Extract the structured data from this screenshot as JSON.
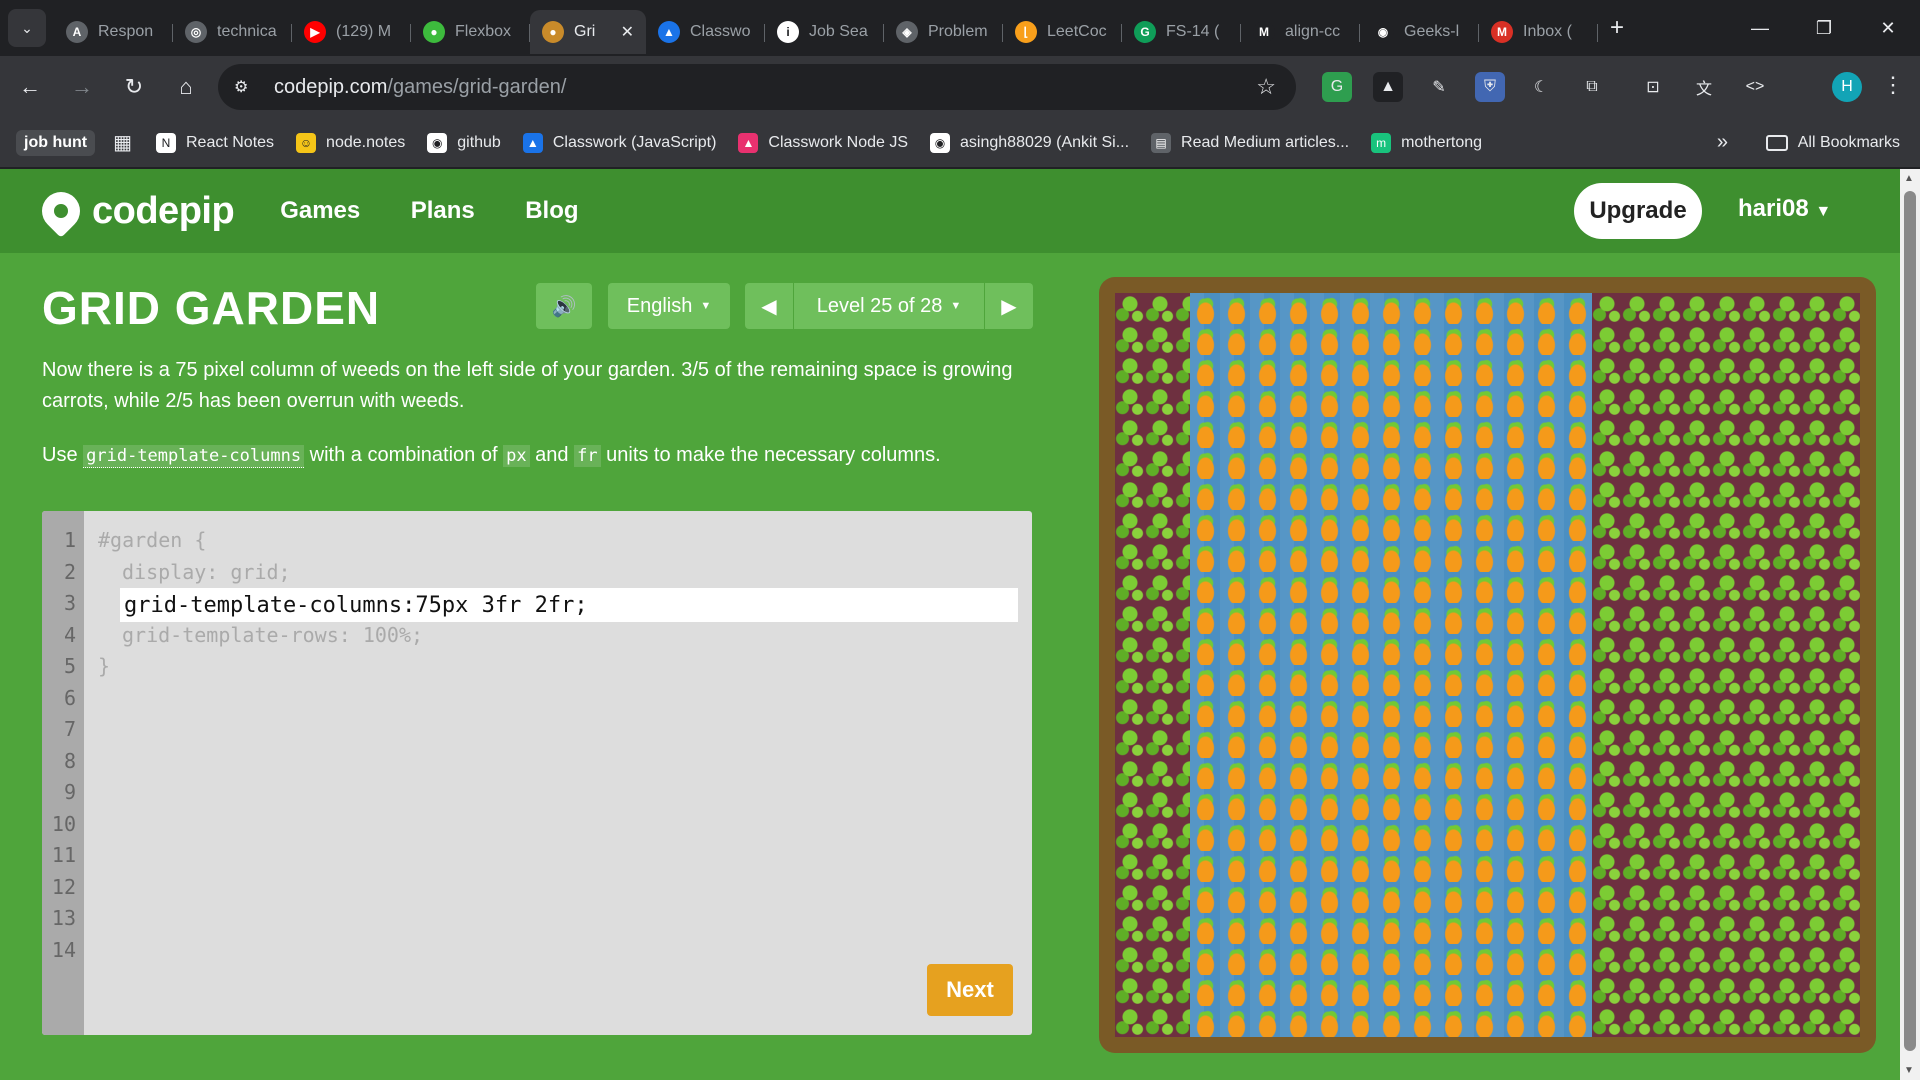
{
  "browser": {
    "tabs": [
      {
        "title": "Respon",
        "fav_color": "#5f6368",
        "fav_glyph": "A",
        "icon": "response-icon"
      },
      {
        "title": "technica",
        "fav_color": "#5f6368",
        "fav_glyph": "◎",
        "icon": "openai-icon"
      },
      {
        "title": "(129) M",
        "fav_color": "#ff0000",
        "fav_glyph": "▶",
        "icon": "youtube-icon"
      },
      {
        "title": "Flexbox",
        "fav_color": "#3dbb3d",
        "fav_glyph": "●",
        "icon": "frog-icon"
      },
      {
        "title": "Gri",
        "fav_color": "#c98b2a",
        "fav_glyph": "●",
        "icon": "carrot-icon",
        "active": true
      },
      {
        "title": "Classwo",
        "fav_color": "#1a73e8",
        "fav_glyph": "▲",
        "icon": "classroom-icon"
      },
      {
        "title": "Job Sea",
        "fav_color": "#ffffff",
        "fav_glyph": "i",
        "icon": "info-icon"
      },
      {
        "title": "Problem",
        "fav_color": "#5f6368",
        "fav_glyph": "◈",
        "icon": "problem-icon"
      },
      {
        "title": "LeetCoc",
        "fav_color": "#f89f1b",
        "fav_glyph": "⌊",
        "icon": "leetcode-icon"
      },
      {
        "title": "FS-14 (",
        "fav_color": "#0f9d58",
        "fav_glyph": "G",
        "icon": "fs-icon"
      },
      {
        "title": "align-cc",
        "fav_color": "#202124",
        "fav_glyph": "M",
        "icon": "medium-icon"
      },
      {
        "title": "Geeks-l",
        "fav_color": "#202124",
        "fav_glyph": "◉",
        "icon": "github-icon"
      },
      {
        "title": "Inbox (",
        "fav_color": "#d93025",
        "fav_glyph": "M",
        "icon": "gmail-icon"
      }
    ],
    "url_host": "codepip.com",
    "url_path": "/games/grid-garden/",
    "bookmarks_folder": "job hunt",
    "bookmarks": [
      {
        "label": "React Notes",
        "color": "#ffffff",
        "glyph": "N"
      },
      {
        "label": "node.notes",
        "color": "#f5c518",
        "glyph": "☺"
      },
      {
        "label": "github",
        "color": "#ffffff",
        "glyph": "◉"
      },
      {
        "label": "Classwork (JavaScript)",
        "color": "#1a73e8",
        "glyph": "▲"
      },
      {
        "label": "Classwork Node JS",
        "color": "#e8316f",
        "glyph": "▲"
      },
      {
        "label": "asingh88029 (Ankit Si...",
        "color": "#ffffff",
        "glyph": "◉"
      },
      {
        "label": "Read Medium articles...",
        "color": "#5f6368",
        "glyph": "▤"
      },
      {
        "label": "mothertong",
        "color": "#19c37d",
        "glyph": "m"
      }
    ],
    "all_bookmarks": "All Bookmarks",
    "profile_initial": "H"
  },
  "site": {
    "logo": "codepip",
    "nav": [
      "Games",
      "Plans",
      "Blog"
    ],
    "upgrade": "Upgrade",
    "user": "hari08"
  },
  "game": {
    "title": "GRID GARDEN",
    "language": "English",
    "level": "Level 25 of 28",
    "instruction_1": "Now there is a 75 pixel column of weeds on the left side of your garden. 3/5 of the remaining space is growing carrots, while 2/5 has been overrun with weeds.",
    "instruction_2_prefix": "Use",
    "instruction_2_code": "grid-template-columns",
    "instruction_2_mid": "with a combination of",
    "unit_px": "px",
    "instruction_2_and": "and",
    "unit_fr": "fr",
    "instruction_2_suffix": "units to make the necessary columns.",
    "line_numbers": [
      "1",
      "2",
      "3",
      "4",
      "5",
      "6",
      "7",
      "8",
      "9",
      "10",
      "11",
      "12",
      "13",
      "14"
    ],
    "code_line_1": "#garden {",
    "code_line_2": "display: grid;",
    "code_input": "grid-template-columns:75px 3fr 2fr;",
    "code_line_4": "grid-template-rows: 100%;",
    "code_line_5": "}",
    "next": "Next"
  }
}
